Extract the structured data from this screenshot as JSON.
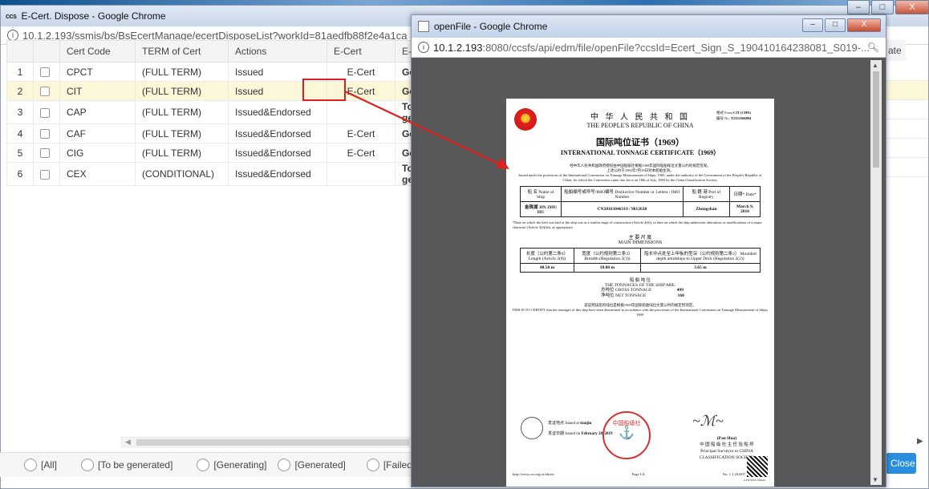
{
  "main_window": {
    "title": "E-Cert. Dispose - Google Chrome",
    "logo_text": "ccs",
    "url": "10.1.2.193/ssmis/bs/BsEcertManage/ecertDisposeList?workId=81aedfb88f2e4a1ca",
    "info_icon": "i"
  },
  "table": {
    "headers": [
      "Cert Code",
      "TERM of Cert",
      "Actions",
      "E-Cert",
      "E-Cert St"
    ],
    "rows": [
      {
        "num": "1",
        "code": "CPCT",
        "term": "(FULL TERM)",
        "action": "Issued",
        "ecert": "E-Cert",
        "status": "Generat",
        "status_color": "green"
      },
      {
        "num": "2",
        "code": "CIT",
        "term": "(FULL TERM)",
        "action": "Issued",
        "ecert": "E-Cert",
        "status": "Generat",
        "status_color": "green"
      },
      {
        "num": "3",
        "code": "CAP",
        "term": "(FULL TERM)",
        "action": "Issued&Endorsed",
        "ecert": "",
        "status": "To be gene",
        "status_color": "red"
      },
      {
        "num": "4",
        "code": "CAF",
        "term": "(FULL TERM)",
        "action": "Issued&Endorsed",
        "ecert": "E-Cert",
        "status": "Genera",
        "status_color": "green"
      },
      {
        "num": "5",
        "code": "CIG",
        "term": "(FULL TERM)",
        "action": "Issued&Endorsed",
        "ecert": "E-Cert",
        "status": "Generat",
        "status_color": "green"
      },
      {
        "num": "6",
        "code": "CEX",
        "term": "(CONDITIONAL)",
        "action": "Issued&Endorsed",
        "ecert": "",
        "status": "To be gene",
        "status_color": "red"
      }
    ],
    "right_header_fragment": "ate"
  },
  "filters": [
    "[All]",
    "[To be generated]",
    "[Generating]",
    "[Generated]",
    "[Failed]"
  ],
  "close_label": "Close",
  "popup": {
    "title": "openFile - Google Chrome",
    "url_host": "10.1.2.193",
    "url_rest": ":8080/ccsfs/api/edm/file/openFile?ccsId=Ecert_Sign_S_190410164238081_S019-...",
    "document": {
      "title_zh": "中 华 人 民 共 和 国",
      "title_en": "THE PEOPLE'S REPUBLIC OF CHINA",
      "form_label": "格式\nForm",
      "form_value": "CIT (CHN)",
      "no_label": "编号\nNo.",
      "no_value": "T2155566894",
      "cert_zh": "国际吨位证书（1969）",
      "cert_en": "INTERNATIONAL TONNAGE CERTIFICATE（1969）",
      "intro_zh": "经中华人民共和国政府授权由中国船级社根据1969年国际船舶吨位丈量公约的规定签发。",
      "intro_zh2": "上述公约于1982年7月18日对本船舶生效。",
      "intro_en": "Issued under the provisions of the International Convention on Tonnage Measurement of Ships, 1969, under the authority of the Government of the People's Republic of China, for which the Convention came into force on 18th of July, 1982 by the China Classification Society.",
      "ship_table_headers": [
        "船 名\nName of Ship",
        "船舶编号或呼号/IMO编号\nDistinctive Number or Letters / IMO Number",
        "船 籍 港\nPort of Registry",
        "日期*\nDate*"
      ],
      "ship_row": [
        "金珠湖\nJIN ZHU HU",
        "CN20163046319 / 9812638",
        "Zhongshan",
        "March 9, 2016"
      ],
      "notes": "*Date on which the keel was laid or the ship was at a similar stage of construction (Article 2(6)), or date on which the ship underwent alterations or modifications of a major character (Article 3(2)(b)), as appropriate.",
      "dims_zh": "主 要 尺 度",
      "dims_en": "MAIN DIMENSIONS",
      "dims_headers": [
        "长度（公约第二条8）\nLength (Article 2(8))",
        "宽度（公约规则第二条3）\nBreadth (Regulation 2(3))",
        "船长中点处至上甲板的型深（公约规则第二条2）\nMoulded depth amidships to Upper Deck (Regulation 2(2))"
      ],
      "dims_values": [
        "48.50 m",
        "10.80 m",
        "3.65 m"
      ],
      "tonnage_zh": "船 舶 吨 位",
      "tonnage_en": "THE TONNAGES OF THE SHIP ARE:",
      "gross_label": "总吨位\nGROSS TONNAGE",
      "gross_value": "499",
      "net_label": "净吨位\nNET TONNAGE",
      "net_value": "160",
      "certify_zh": "兹证明该船的吨位是根据1969年国际船舶吨位丈量公约的规定所测定。",
      "certify_en": "THIS IS TO CERTIFY that the tonnages of this ship have been determined in accordance with the provisions of the International Convention on Tonnage Measurement of Ships, 1969.",
      "issued_at_label": "发证地点\nIssued at",
      "issued_at": "tianjin",
      "issued_on_label": "发证日期\nIssued on",
      "issued_on": "February 28, 2019",
      "signer": "(Pan Hua)",
      "signer_title_zh": "中 国 船 级 社 主 任 验 船 师",
      "signer_title_en": "Principal Surveyor to CHINA CLASSIFICATION SOCIETY",
      "stamp_text": "中国船级社",
      "footer_url": "http://www.ccs.org.cn/ebcert",
      "footer_page": "Page 1/4",
      "footer_ver": "Ver. 1.1 201407",
      "utn": "UTN:S019-708445"
    }
  },
  "colors": {
    "link": "#2a6fc9",
    "generated": "#2e8f1f",
    "pending": "#e02020",
    "close_button": "#2a8ee0",
    "highlight": "#e02020"
  }
}
